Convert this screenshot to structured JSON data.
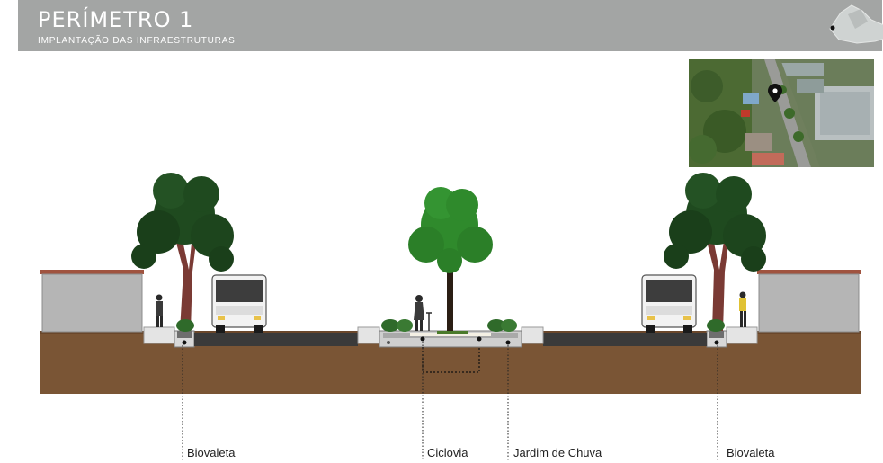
{
  "header": {
    "title": "PERÍMETRO 1",
    "subtitle": "IMPLANTAÇÃO DAS INFRAESTRUTURAS"
  },
  "labels": {
    "biovaleta_left": "Biovaleta",
    "ciclovia": "Ciclovia",
    "jardim_de_chuva": "Jardim de Chuva",
    "biovaleta_right": "Biovaleta"
  },
  "colors": {
    "header_bg": "#a3a5a4",
    "soil": "#7a5535",
    "asphalt": "#3a3a3a",
    "wall": "#b5b5b5",
    "tree_dark": "#1f4a1f",
    "tree_light": "#2f8a2c"
  },
  "icons": {
    "location": "map-pin-icon"
  }
}
